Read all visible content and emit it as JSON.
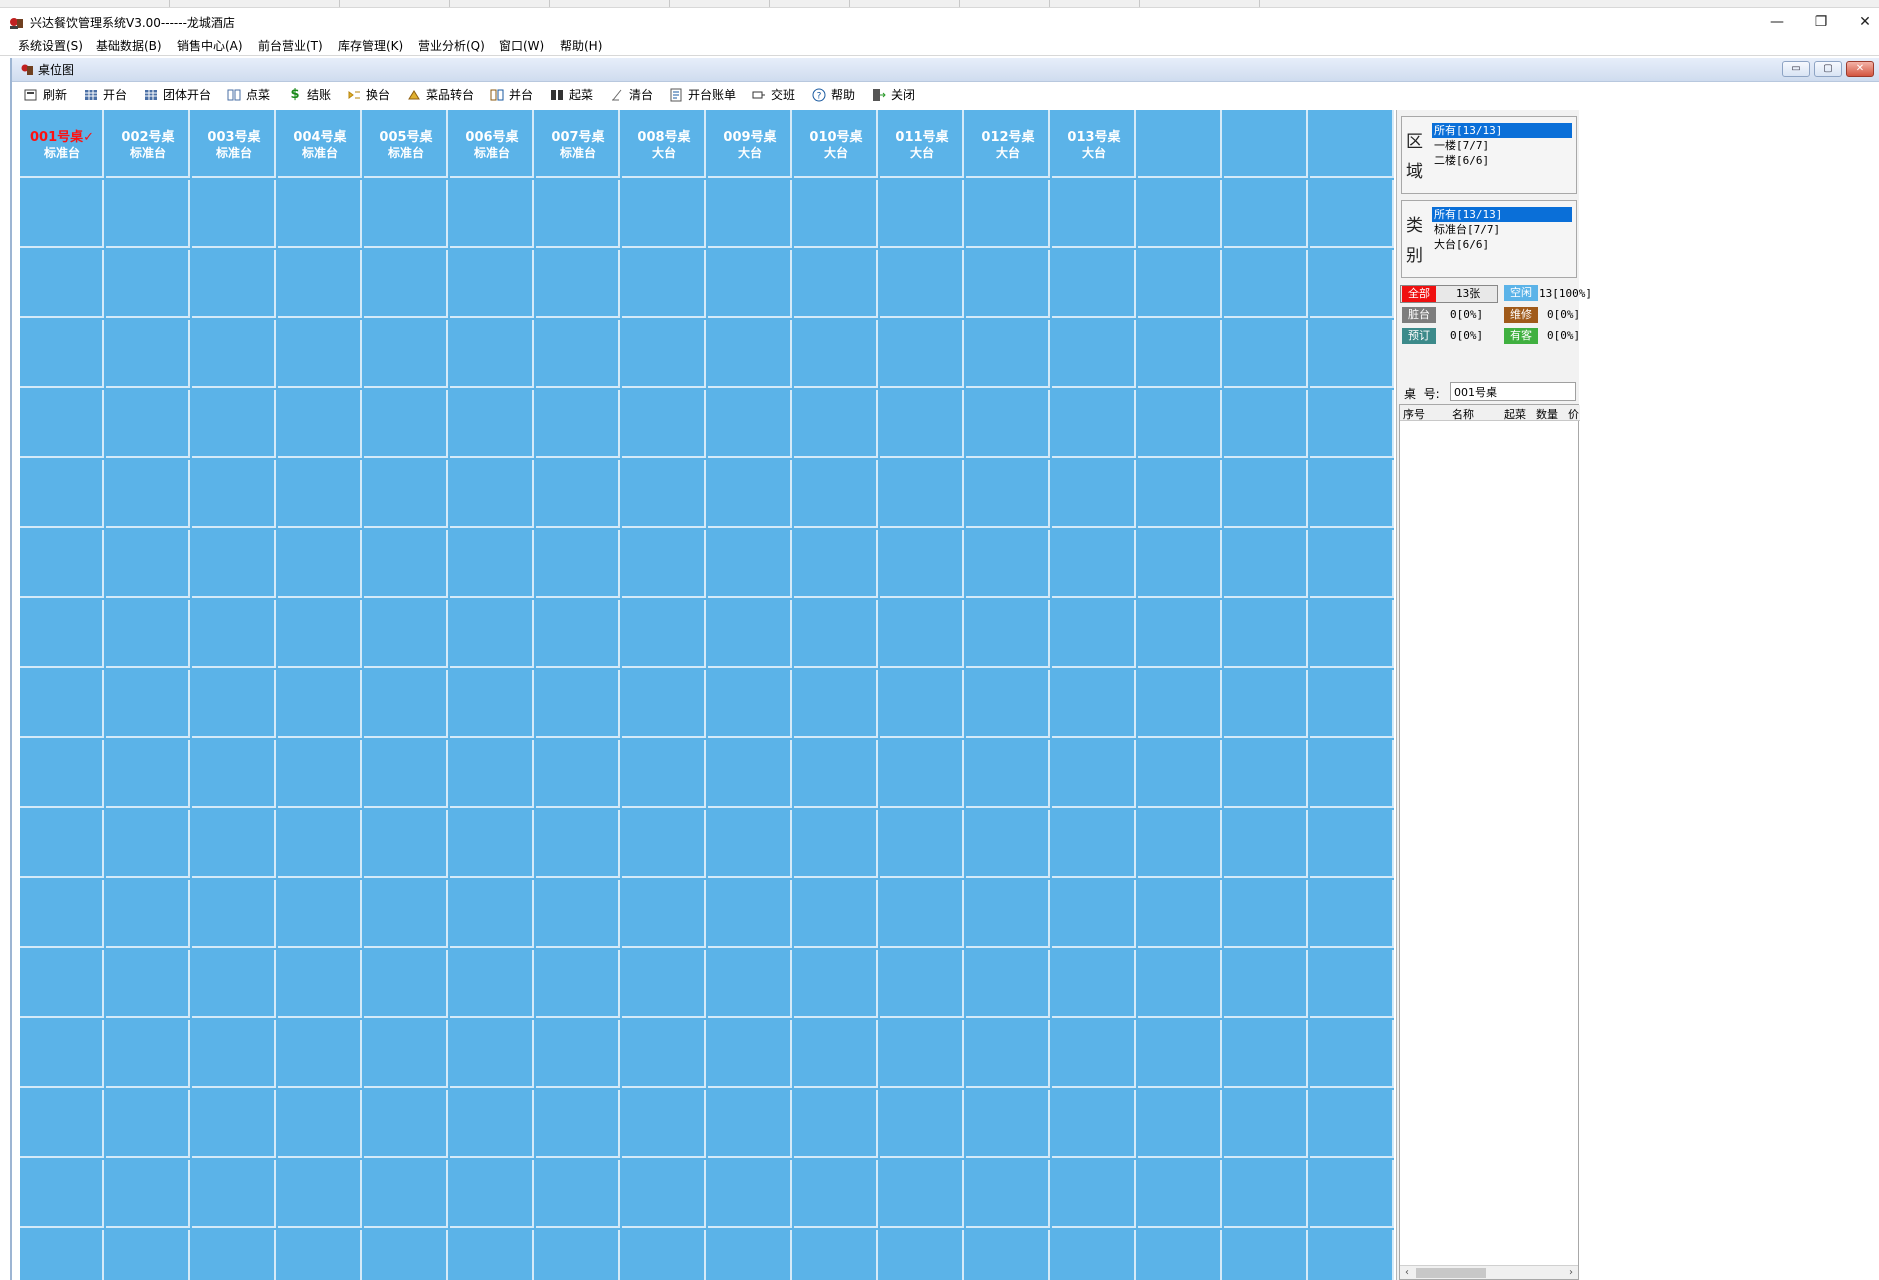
{
  "window": {
    "title": "兴达餐饮管理系统V3.00------龙城酒店",
    "minimize": "—",
    "restore": "❐",
    "close": "✕"
  },
  "menu": [
    {
      "id": "system",
      "label": "系统设置(S)"
    },
    {
      "id": "basic",
      "label": "基础数据(B)"
    },
    {
      "id": "sales",
      "label": "销售中心(A)"
    },
    {
      "id": "front",
      "label": "前台营业(T)"
    },
    {
      "id": "stock",
      "label": "库存管理(K)"
    },
    {
      "id": "analysis",
      "label": "营业分析(Q)"
    },
    {
      "id": "window",
      "label": "窗口(W)"
    },
    {
      "id": "help",
      "label": "帮助(H)"
    }
  ],
  "child": {
    "title": "桌位图",
    "btn_min": "▭",
    "btn_max": "▢",
    "btn_close": "✕"
  },
  "toolbar": [
    {
      "id": "refresh",
      "label": "刷新",
      "icon": "refresh-icon"
    },
    {
      "id": "open",
      "label": "开台",
      "icon": "table-icon"
    },
    {
      "id": "group-open",
      "label": "团体开台",
      "icon": "group-table-icon"
    },
    {
      "id": "order",
      "label": "点菜",
      "icon": "menu-icon"
    },
    {
      "id": "checkout",
      "label": "结账",
      "icon": "dollar-icon"
    },
    {
      "id": "switch",
      "label": "换台",
      "icon": "switch-icon"
    },
    {
      "id": "dish-transfer",
      "label": "菜品转台",
      "icon": "transfer-icon"
    },
    {
      "id": "merge",
      "label": "并台",
      "icon": "merge-icon"
    },
    {
      "id": "serve",
      "label": "起菜",
      "icon": "serve-icon"
    },
    {
      "id": "clear",
      "label": "清台",
      "icon": "broom-icon"
    },
    {
      "id": "bill",
      "label": "开台账单",
      "icon": "bill-icon"
    },
    {
      "id": "shift",
      "label": "交班",
      "icon": "shift-icon"
    },
    {
      "id": "help",
      "label": "帮助",
      "icon": "help-icon"
    },
    {
      "id": "close",
      "label": "关闭",
      "icon": "exit-icon"
    }
  ],
  "tables": [
    {
      "name": "001号桌✓",
      "type": "标准台",
      "selected": true
    },
    {
      "name": "002号桌",
      "type": "标准台"
    },
    {
      "name": "003号桌",
      "type": "标准台"
    },
    {
      "name": "004号桌",
      "type": "标准台"
    },
    {
      "name": "005号桌",
      "type": "标准台"
    },
    {
      "name": "006号桌",
      "type": "标准台"
    },
    {
      "name": "007号桌",
      "type": "标准台"
    },
    {
      "name": "008号桌",
      "type": "大台"
    },
    {
      "name": "009号桌",
      "type": "大台"
    },
    {
      "name": "010号桌",
      "type": "大台"
    },
    {
      "name": "011号桌",
      "type": "大台"
    },
    {
      "name": "012号桌",
      "type": "大台"
    },
    {
      "name": "013号桌",
      "type": "大台"
    }
  ],
  "area_filter": {
    "label_top": "区",
    "label_bottom": "域",
    "items": [
      "所有[13/13]",
      "一楼[7/7]",
      "二楼[6/6]"
    ]
  },
  "type_filter": {
    "label_top": "类",
    "label_bottom": "别",
    "items": [
      "所有[13/13]",
      "标准台[7/7]",
      "大台[6/6]"
    ]
  },
  "stats": {
    "all": {
      "label": "全部",
      "value": "13张",
      "color": "#f01010"
    },
    "idle": {
      "label": "空闲",
      "value": "13[100%]",
      "color": "#5bb3e8"
    },
    "dirty": {
      "label": "脏台",
      "value": "0[0%]",
      "color": "#7d7d7d"
    },
    "repair": {
      "label": "维修",
      "value": "0[0%]",
      "color": "#a05a1a"
    },
    "reserved": {
      "label": "预订",
      "value": "0[0%]",
      "color": "#3c8a8a"
    },
    "occupied": {
      "label": "有客",
      "value": "0[0%]",
      "color": "#40b040"
    }
  },
  "table_no": {
    "label": "桌  号:",
    "value": "001号桌"
  },
  "orders_header": [
    "序号",
    "名称",
    "起菜",
    "数量",
    "价"
  ]
}
